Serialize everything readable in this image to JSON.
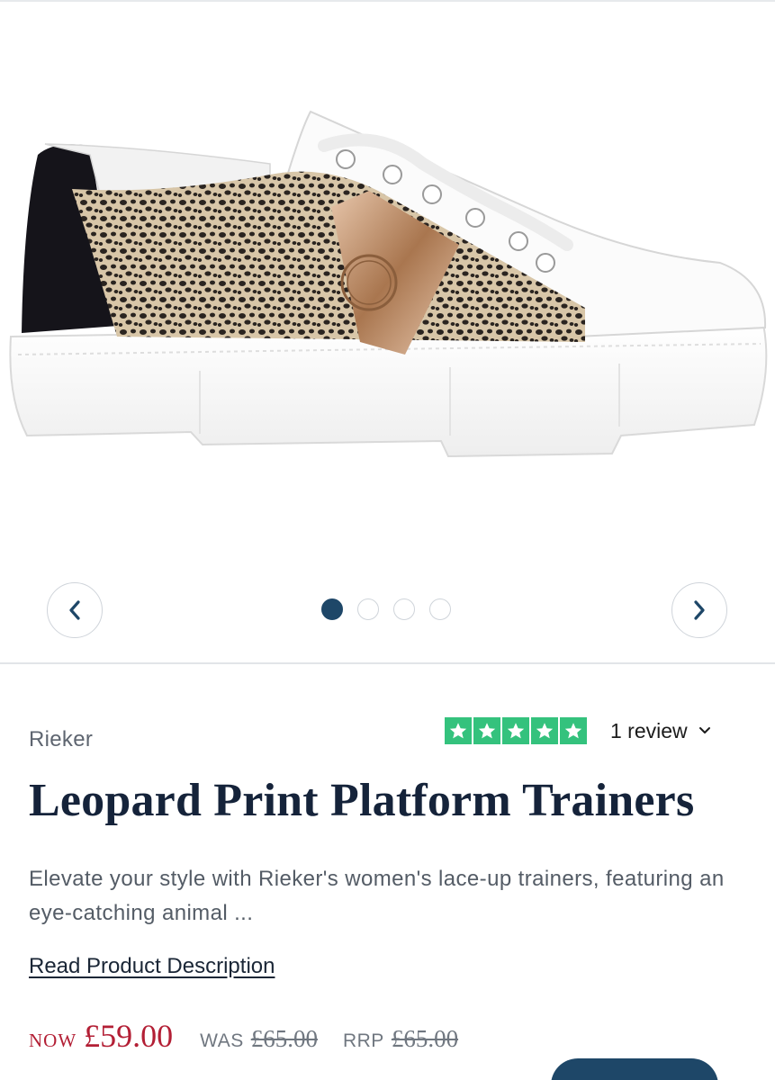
{
  "gallery": {
    "image_alt": "Leopard print platform trainer",
    "slide_count": 4,
    "active_slide": 1,
    "prev_icon": "chevron-left-icon",
    "next_icon": "chevron-right-icon"
  },
  "product": {
    "brand": "Rieker",
    "title": "Leopard Print Platform Trainers",
    "description": "Elevate your style with Rieker's women's lace-up trainers, featuring an eye-catching animal ...",
    "read_more": "Read Product Description"
  },
  "rating": {
    "stars": 5,
    "review_text": "1 review",
    "star_color": "#34c27d"
  },
  "price": {
    "now_label": "NOW",
    "now_value": "£59.00",
    "was_label": "WAS",
    "was_value": "£65.00",
    "rrp_label": "RRP",
    "rrp_value": "£65.00",
    "sale_color": "#b31f35"
  },
  "colors": {
    "accent": "#1e4768",
    "text": "#15233a"
  }
}
